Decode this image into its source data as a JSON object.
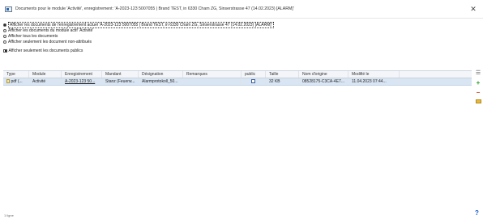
{
  "window": {
    "title": "Documents pour le module 'Activité', enregistrement: 'A-2023-123 5007055 | Brand TEST, in 6330 Cham ZG, Sinserstrasse 47 (14.02.2023) [ALARM]'",
    "icon": "document-window-icon"
  },
  "options": {
    "radios": [
      {
        "label": "Afficher les documents de l'enregistrement actuel 'A-2023-123 5007055 | Brand TEST, in 6330 Cham ZG, Sinserstrasse 47 (14.02.2023) [ALARM]'",
        "checked": true
      },
      {
        "label": "Afficher les documents du module actif 'Activité'",
        "checked": false
      },
      {
        "label": "Afficher tous les documents",
        "checked": false
      },
      {
        "label": "Afficher seulement les document non-attribués",
        "checked": false
      }
    ],
    "public_only": {
      "label": "Afficher seulement les documents publics",
      "checked": true
    }
  },
  "table": {
    "columns": [
      "Type",
      "Module",
      "Enregistrement",
      "Mandant",
      "Désignation",
      "Remarques",
      "public",
      "Taille",
      "Nom d'origine",
      "Modifié le"
    ],
    "rows": [
      {
        "type": "pdf (...",
        "module": "Activité",
        "enregistrement": "A-2023-123 50...",
        "mandant": "Stanz (Feuerw...",
        "designation": "Alarmprotokoll_50...",
        "remarques": "",
        "public": false,
        "taille": "32 KB",
        "nom_origine": "08528175-C3CA-4E7...",
        "modifie": "11.04.2023 07:44..."
      }
    ]
  },
  "footer": {
    "count": "1 ligne"
  },
  "tools": {
    "menu": "menu-icon",
    "add": "plus-icon",
    "remove": "minus-icon",
    "folder": "folder-icon",
    "help": "help-icon"
  },
  "colors": {
    "selected_row": "#d9e5f3",
    "add": "#2e9e2e",
    "remove": "#d04a2a",
    "help": "#1c5fc9"
  }
}
